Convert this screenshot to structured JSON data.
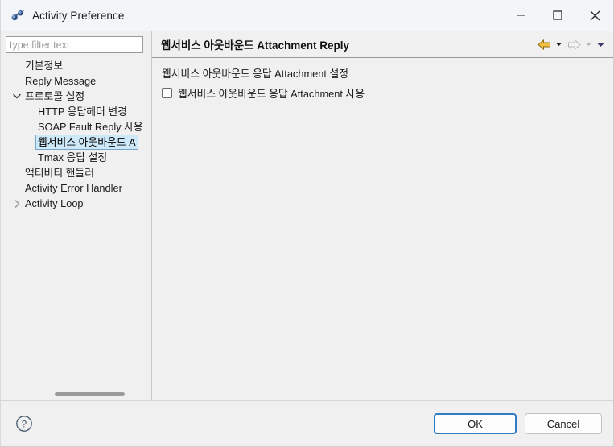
{
  "window": {
    "title": "Activity Preference",
    "icon": "activity-preference-icon",
    "controls": {
      "minimize_label": "Minimize",
      "maximize_label": "Maximize",
      "close_label": "Close"
    }
  },
  "left_pane": {
    "filter": {
      "placeholder": "type filter text",
      "value": ""
    },
    "tree": [
      {
        "label": "기본정보",
        "indent": 1,
        "twisty": "none",
        "selected": false
      },
      {
        "label": "Reply Message",
        "indent": 1,
        "twisty": "none",
        "selected": false
      },
      {
        "label": "프로토콜 설정",
        "indent": 0,
        "twisty": "expanded",
        "selected": false
      },
      {
        "label": "HTTP 응답헤더 변경",
        "indent": 2,
        "twisty": "none",
        "selected": false
      },
      {
        "label": "SOAP Fault Reply 사용",
        "indent": 2,
        "twisty": "none",
        "selected": false
      },
      {
        "label": "웹서비스 아웃바운드 A",
        "indent": 2,
        "twisty": "none",
        "selected": true
      },
      {
        "label": "Tmax 응답 설정",
        "indent": 2,
        "twisty": "none",
        "selected": false
      },
      {
        "label": "액티비티 핸들러",
        "indent": 1,
        "twisty": "none",
        "selected": false
      },
      {
        "label": "Activity Error Handler",
        "indent": 1,
        "twisty": "none",
        "selected": false
      },
      {
        "label": "Activity Loop",
        "indent": 0,
        "twisty": "collapsed",
        "selected": false
      }
    ],
    "scrollbar": {
      "name": "tree-horizontal-scrollbar"
    }
  },
  "right_pane": {
    "page_title": "웹서비스 아웃바운드 Attachment Reply",
    "nav": {
      "back_icon": "back-arrow-icon",
      "back_dropdown_icon": "chevron-down-icon",
      "forward_icon": "forward-arrow-icon",
      "forward_dropdown_icon": "chevron-down-icon",
      "menu_dropdown_icon": "chevron-down-icon"
    },
    "group_label": "웹서비스 아웃바운드 응답 Attachment 설정",
    "checkbox": {
      "label": "웹서비스 아웃바운드 응답 Attachment 사용",
      "checked": false
    }
  },
  "footer": {
    "help_icon": "help-question-icon",
    "ok_label": "OK",
    "cancel_label": "Cancel"
  },
  "colors": {
    "window_bg": "#f0f0f0",
    "titlebar_bg": "#f3f5f9",
    "selection_bg": "#cde8f8",
    "selection_border": "#7aa7c7",
    "focus_border": "#2f7cc4",
    "back_arrow": "#e9b64b",
    "forward_arrow": "#d6d6d6",
    "separator": "#9a9a9a"
  }
}
